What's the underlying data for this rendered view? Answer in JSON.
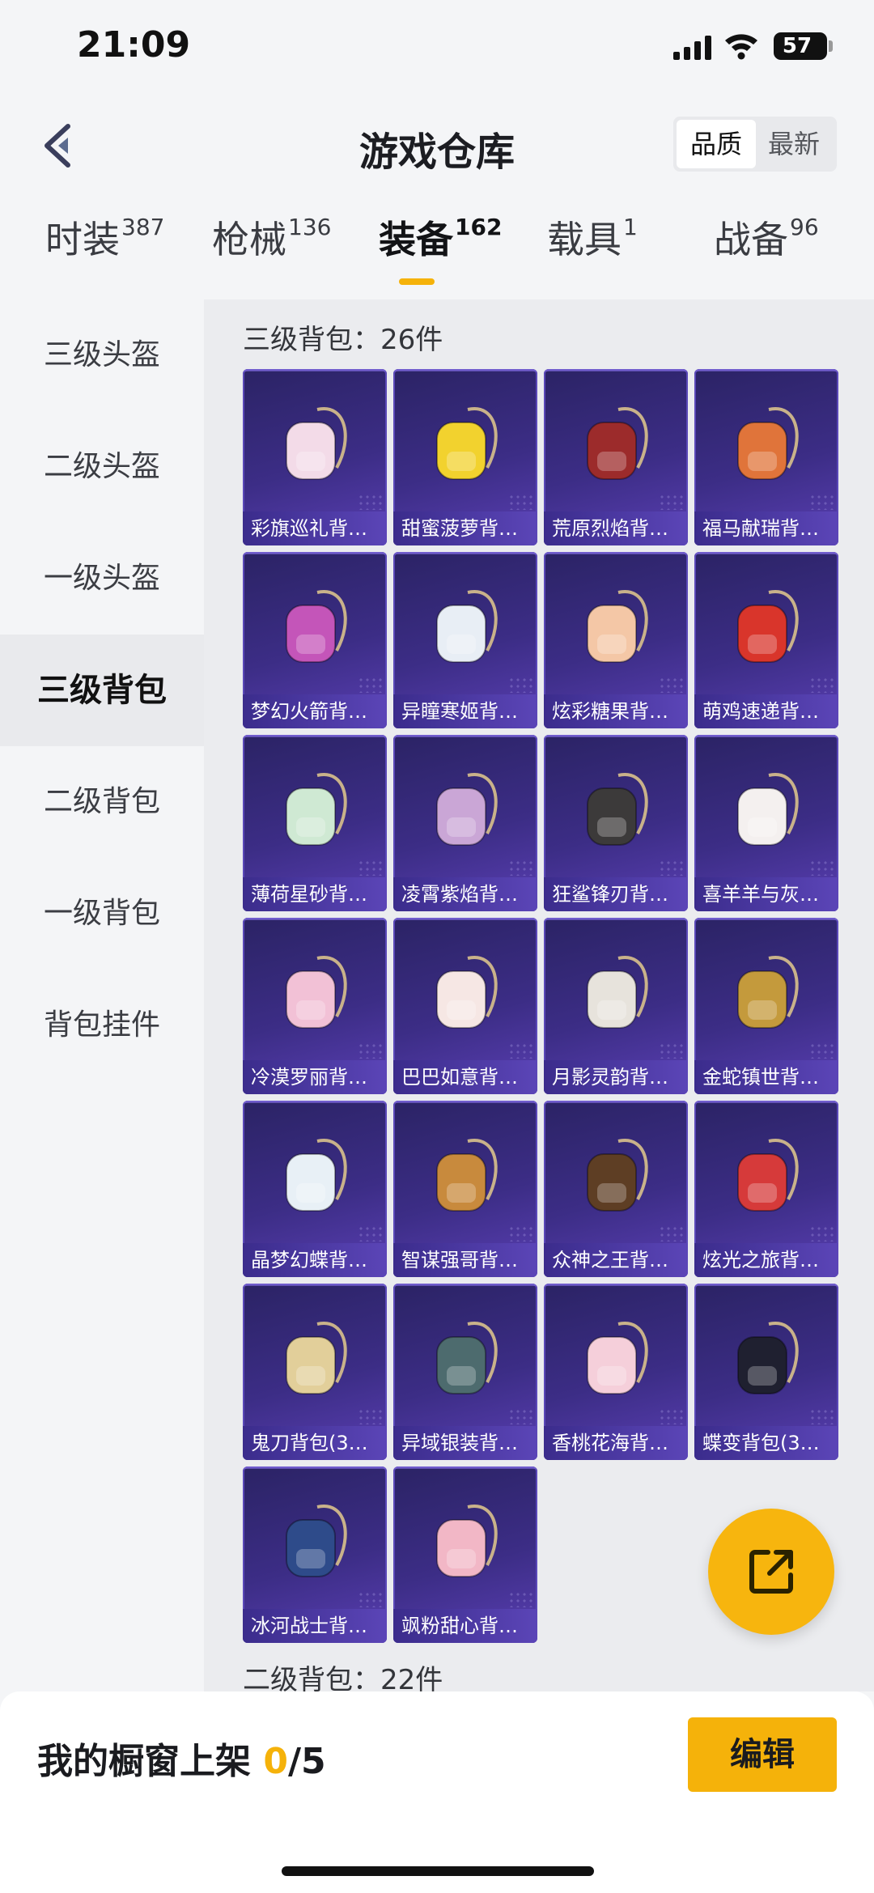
{
  "status_bar": {
    "time": "21:09",
    "battery": "57"
  },
  "header": {
    "title": "游戏仓库",
    "sort": [
      "品质",
      "最新"
    ]
  },
  "tabs": [
    {
      "label": "时装",
      "count": "387"
    },
    {
      "label": "枪械",
      "count": "136"
    },
    {
      "label": "装备",
      "count": "162"
    },
    {
      "label": "载具",
      "count": "1"
    },
    {
      "label": "战备",
      "count": "96"
    }
  ],
  "sidebar": [
    "三级头盔",
    "二级头盔",
    "一级头盔",
    "三级背包",
    "二级背包",
    "一级背包",
    "背包挂件"
  ],
  "sections": [
    {
      "title": "三级背包：26件"
    },
    {
      "title": "二级背包：22件"
    }
  ],
  "items": [
    "彩旗巡礼背…",
    "甜蜜菠萝背…",
    "荒原烈焰背…",
    "福马献瑞背…",
    "梦幻火箭背…",
    "异瞳寒姬背…",
    "炫彩糖果背…",
    "萌鸡速递背…",
    "薄荷星砂背…",
    "凌霄紫焰背…",
    "狂鲨锋刃背…",
    "喜羊羊与灰…",
    "冷漠罗丽背…",
    "巴巴如意背…",
    "月影灵韵背…",
    "金蛇镇世背…",
    "晶梦幻蝶背…",
    "智谋强哥背…",
    "众神之王背…",
    "炫光之旅背…",
    "鬼刀背包(3…",
    "异域银装背…",
    "香桃花海背…",
    "蝶变背包(3…",
    "冰河战士背…",
    "飒粉甜心背…"
  ],
  "item_colors": [
    "#f3dbe8",
    "#f2d22e",
    "#9c2b2b",
    "#e0743a",
    "#c455b9",
    "#e8eef5",
    "#f4c7a6",
    "#d9352b",
    "#cfe9d3",
    "#caa6d6",
    "#3c3a3a",
    "#f4f0ef",
    "#f2c1d6",
    "#f6e7e4",
    "#e7e3dc",
    "#c49a3c",
    "#e8f0f6",
    "#c88a3d",
    "#5e3e24",
    "#d63a3a",
    "#e2cf9a",
    "#4d6b6e",
    "#f5cfda",
    "#1f2030",
    "#2e4b8a",
    "#f2b7c6"
  ],
  "bottom": {
    "showcase_label": "我的橱窗上架",
    "showcase_count": "0",
    "showcase_total": "/5",
    "edit": "编辑"
  }
}
